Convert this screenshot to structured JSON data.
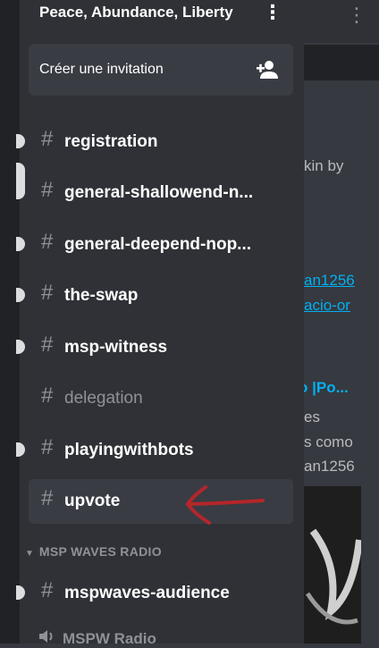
{
  "server": {
    "name": "Peace, Abundance, Liberty"
  },
  "invite": {
    "label": "Créer une invitation"
  },
  "channels": [
    {
      "name": "registration"
    },
    {
      "name": "general-shallowend-n..."
    },
    {
      "name": "general-deepend-nop..."
    },
    {
      "name": "the-swap"
    },
    {
      "name": "msp-witness"
    },
    {
      "name": "delegation"
    },
    {
      "name": "playingwithbots"
    },
    {
      "name": "upvote"
    }
  ],
  "category": {
    "name": "MSP WAVES RADIO"
  },
  "category_channels": [
    {
      "name": "mspwaves-audience"
    }
  ],
  "voice_channel": {
    "name": "MSPW Radio"
  },
  "background_chat": {
    "lines": [
      "kin by",
      "an1256",
      "acio-or",
      "o |Po...",
      "es",
      "s como",
      "an1256"
    ]
  },
  "colors": {
    "panel": "#2f3136",
    "selected_row": "#393c43",
    "annotation_arrow": "#b5262b",
    "link": "#00b0f4"
  }
}
